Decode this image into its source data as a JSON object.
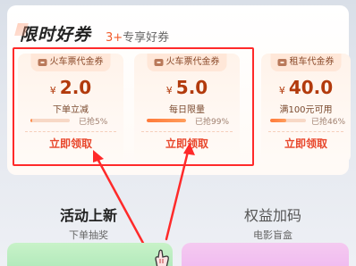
{
  "panel": {
    "title": "限时好券",
    "subtitle_num": "3+",
    "subtitle_text": "专享好券"
  },
  "coupons": [
    {
      "badge": "火车票代金券",
      "currency": "¥",
      "amount": "2.0",
      "desc": "下单立减",
      "progress": 0.05,
      "grabbed": "已抢5%",
      "claim": "立即领取"
    },
    {
      "badge": "火车票代金券",
      "currency": "¥",
      "amount": "5.0",
      "desc": "每日限量",
      "progress": 0.99,
      "grabbed": "已抢99%",
      "claim": "立即领取"
    },
    {
      "badge": "租车代金券",
      "currency": "¥",
      "amount": "40.0",
      "desc": "满100元可用",
      "progress": 0.46,
      "grabbed": "已抢46%",
      "claim": "立即领取"
    }
  ],
  "sections": {
    "left_title": "活动上新",
    "left_sub": "下单抽奖",
    "right_title": "权益加码",
    "right_sub": "电影盲盒"
  },
  "colors": {
    "accent": "#e8472c",
    "amount": "#b23a0c",
    "highlight": "#ff2a2a"
  }
}
